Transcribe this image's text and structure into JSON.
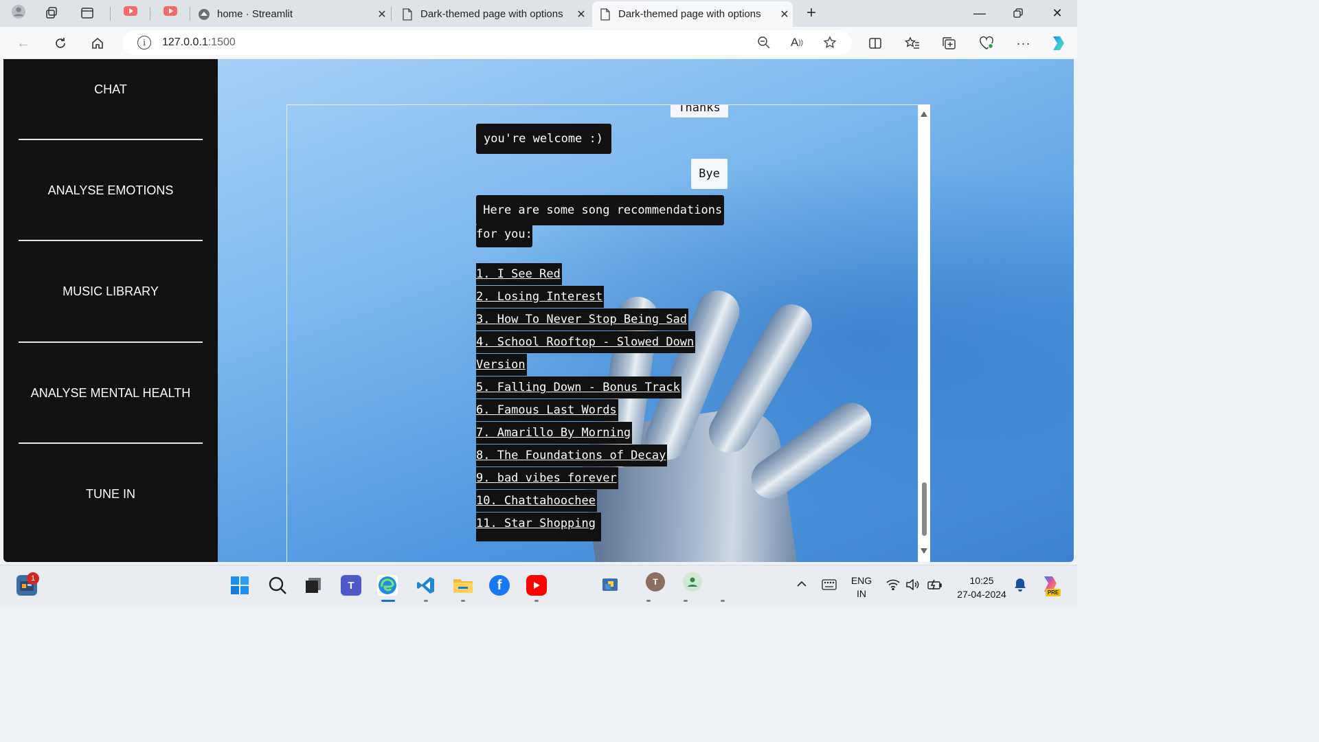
{
  "browser": {
    "tabs": [
      {
        "title": "home · Streamlit",
        "active": false
      },
      {
        "title": "Dark-themed page with options",
        "active": false
      },
      {
        "title": "Dark-themed page with options",
        "active": true
      }
    ],
    "url_host": "127.0.0.1",
    "url_port": ":1500"
  },
  "sidebar": {
    "items": [
      {
        "label": "CHAT"
      },
      {
        "label": "ANALYSE EMOTIONS"
      },
      {
        "label": "MUSIC LIBRARY"
      },
      {
        "label": "ANALYSE MENTAL HEALTH"
      },
      {
        "label": "TUNE IN"
      }
    ]
  },
  "chat": {
    "partial_user_message": "Thanks",
    "messages": [
      {
        "role": "bot",
        "text": "you're welcome :)"
      },
      {
        "role": "user",
        "text": "Bye"
      },
      {
        "role": "bot",
        "line1": " Here are some song recommendations",
        "line2": "for you:"
      }
    ],
    "songs": [
      "1. I See Red",
      "2. Losing Interest",
      "3. How To Never Stop Being Sad",
      "4. School Rooftop - Slowed Down",
      "Version",
      "5. Falling Down - Bonus Track",
      "6. Famous Last Words",
      "7. Amarillo By Morning",
      "8. The Foundations of Decay",
      "9. bad vibes forever",
      "10. Chattahoochee",
      "11. Star Shopping"
    ]
  },
  "taskbar": {
    "notification_badge": "1",
    "lang_line1": "ENG",
    "lang_line2": "IN",
    "time": "10:25",
    "date": "27-04-2024",
    "copilot_badge": "PRE"
  },
  "colors": {
    "sidebar_bg": "#111111",
    "bot_bubble": "#111111",
    "user_bubble": "#f3f6fa",
    "background_blue": "#7db8ee"
  }
}
